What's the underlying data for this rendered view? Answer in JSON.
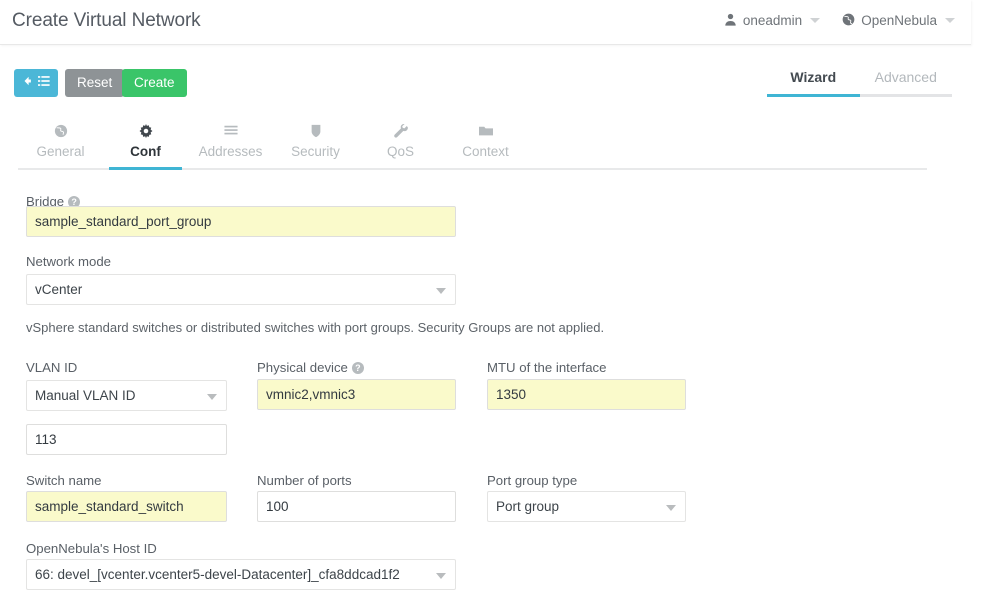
{
  "header": {
    "title": "Create Virtual Network",
    "user": {
      "label": "oneadmin",
      "icon": "user-icon"
    },
    "zone": {
      "label": "OpenNebula",
      "icon": "globe-icon"
    }
  },
  "toolbar": {
    "back_label": "",
    "reset_label": "Reset",
    "create_label": "Create"
  },
  "mode": {
    "wizard_label": "Wizard",
    "advanced_label": "Advanced",
    "active": "Wizard"
  },
  "tabs": [
    {
      "label": "General",
      "icon": "globe-icon",
      "active": false
    },
    {
      "label": "Conf",
      "icon": "gear-icon",
      "active": true
    },
    {
      "label": "Addresses",
      "icon": "list-icon",
      "active": false
    },
    {
      "label": "Security",
      "icon": "shield-icon",
      "active": false
    },
    {
      "label": "QoS",
      "icon": "wrench-icon",
      "active": false
    },
    {
      "label": "Context",
      "icon": "folder-icon",
      "active": false
    }
  ],
  "form": {
    "bridge": {
      "label": "Bridge",
      "value": "sample_standard_port_group",
      "placeholder": "",
      "highlighted": true
    },
    "network_mode": {
      "label": "Network mode",
      "value": "vCenter"
    },
    "description": "vSphere standard switches or distributed switches with port groups. Security Groups are not applied.",
    "vlan_id": {
      "label": "VLAN ID",
      "value": "Manual VLAN ID"
    },
    "physical_device": {
      "label": "Physical device",
      "value": "vmnic2,vmnic3",
      "placeholder": "",
      "highlighted": true
    },
    "mtu": {
      "label": "MTU of the interface",
      "value": "1350",
      "placeholder": "",
      "highlighted": true
    },
    "vlan_id_value": {
      "label": "",
      "value": "113",
      "placeholder": "",
      "highlighted": false
    },
    "switch_name": {
      "label": "Switch name",
      "value": "sample_standard_switch",
      "placeholder": "",
      "highlighted": true
    },
    "number_of_ports": {
      "label": "Number of ports",
      "value": "100",
      "placeholder": "",
      "highlighted": false
    },
    "port_group_type": {
      "label": "Port group type",
      "value": "Port group"
    },
    "host_id": {
      "label": "OpenNebula's Host ID",
      "value": "66: devel_[vcenter.vcenter5-devel-Datacenter]_cfa8ddcad1f2"
    }
  },
  "colors": {
    "accent": "#3fb5d4",
    "create": "#3ac569",
    "reset": "#8e9396",
    "back": "#4bb7d7",
    "highlight_field": "#fafacb"
  }
}
